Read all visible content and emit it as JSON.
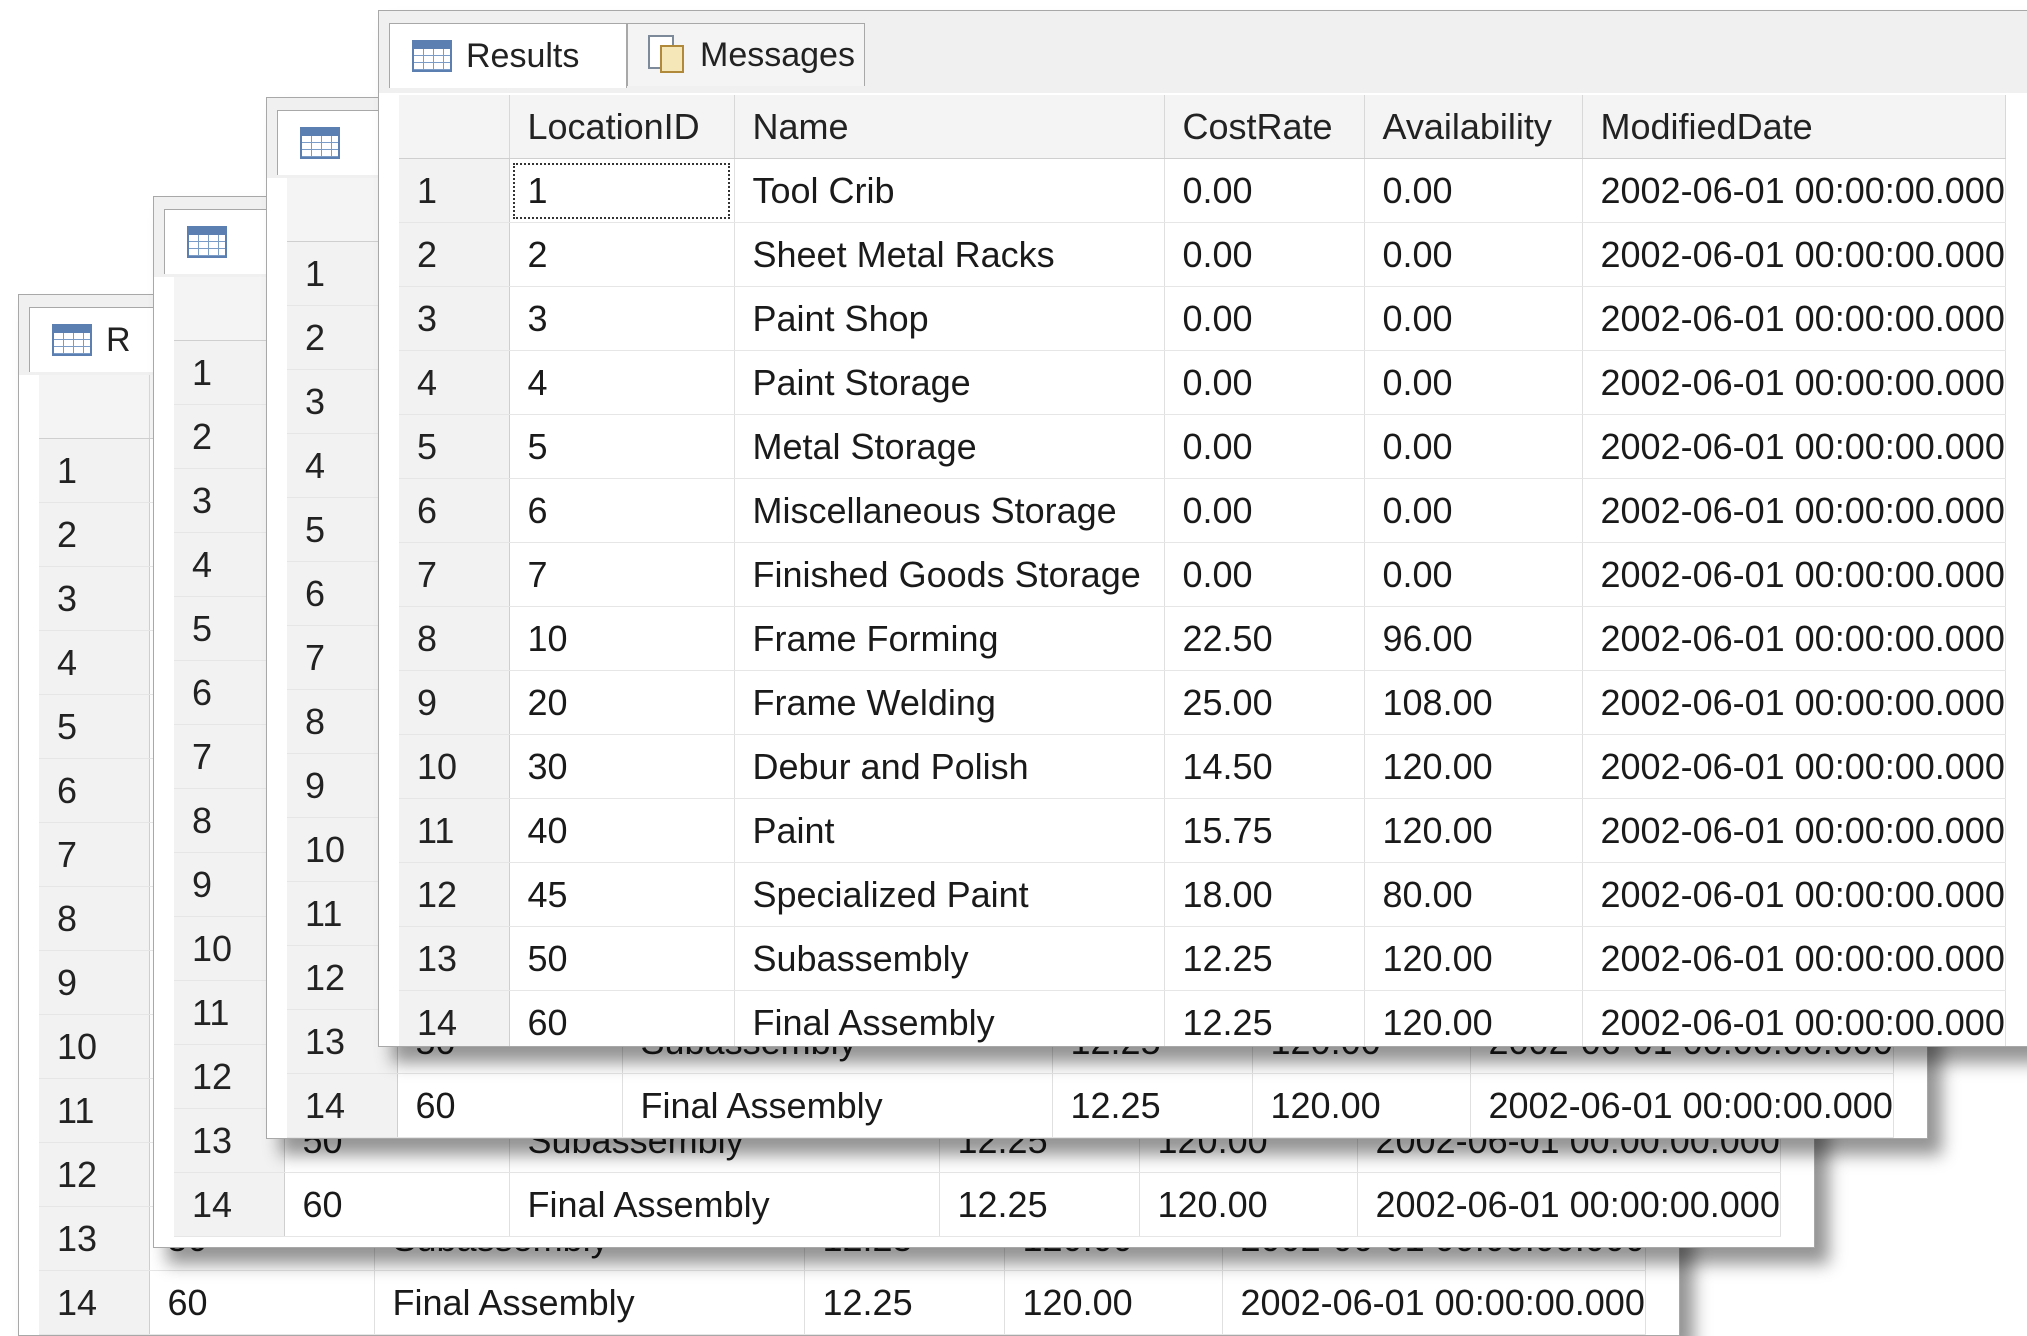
{
  "tabs": {
    "results": "Results",
    "messages": "Messages"
  },
  "columns": [
    "",
    "LocationID",
    "Name",
    "CostRate",
    "Availability",
    "ModifiedDate"
  ],
  "rows": [
    [
      "1",
      "1",
      "Tool Crib",
      "0.00",
      "0.00",
      "2002-06-01 00:00:00.000"
    ],
    [
      "2",
      "2",
      "Sheet Metal Racks",
      "0.00",
      "0.00",
      "2002-06-01 00:00:00.000"
    ],
    [
      "3",
      "3",
      "Paint Shop",
      "0.00",
      "0.00",
      "2002-06-01 00:00:00.000"
    ],
    [
      "4",
      "4",
      "Paint Storage",
      "0.00",
      "0.00",
      "2002-06-01 00:00:00.000"
    ],
    [
      "5",
      "5",
      "Metal Storage",
      "0.00",
      "0.00",
      "2002-06-01 00:00:00.000"
    ],
    [
      "6",
      "6",
      "Miscellaneous Storage",
      "0.00",
      "0.00",
      "2002-06-01 00:00:00.000"
    ],
    [
      "7",
      "7",
      "Finished Goods Storage",
      "0.00",
      "0.00",
      "2002-06-01 00:00:00.000"
    ],
    [
      "8",
      "10",
      "Frame Forming",
      "22.50",
      "96.00",
      "2002-06-01 00:00:00.000"
    ],
    [
      "9",
      "20",
      "Frame Welding",
      "25.00",
      "108.00",
      "2002-06-01 00:00:00.000"
    ],
    [
      "10",
      "30",
      "Debur and Polish",
      "14.50",
      "120.00",
      "2002-06-01 00:00:00.000"
    ],
    [
      "11",
      "40",
      "Paint",
      "15.75",
      "120.00",
      "2002-06-01 00:00:00.000"
    ],
    [
      "12",
      "45",
      "Specialized Paint",
      "18.00",
      "80.00",
      "2002-06-01 00:00:00.000"
    ],
    [
      "13",
      "50",
      "Subassembly",
      "12.25",
      "120.00",
      "2002-06-01 00:00:00.000"
    ],
    [
      "14",
      "60",
      "Final Assembly",
      "12.25",
      "120.00",
      "2002-06-01 00:00:00.000"
    ]
  ],
  "back_window_partial_tab_label": "R"
}
